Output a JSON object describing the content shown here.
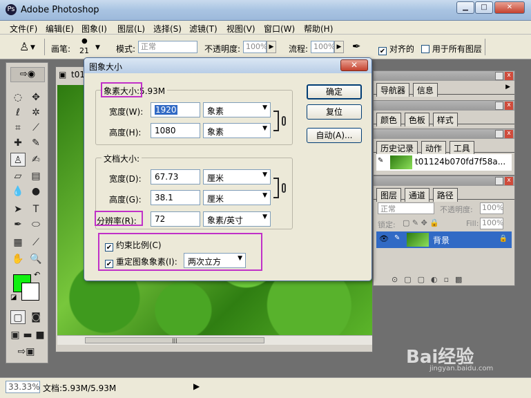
{
  "app": {
    "title": "Adobe Photoshop"
  },
  "window_buttons": {
    "minimize": "▁",
    "maximize": "□",
    "close": "✕"
  },
  "menu": [
    "文件(F)",
    "编辑(E)",
    "图象(I)",
    "图层(L)",
    "选择(S)",
    "滤镜(T)",
    "视图(V)",
    "窗口(W)",
    "帮助(H)"
  ],
  "options_bar": {
    "brush_label": "画笔:",
    "brush_size": "21",
    "mode_label": "模式:",
    "mode_value": "正常",
    "opacity_label": "不透明度:",
    "opacity_value": "100%",
    "flow_label": "流程:",
    "flow_value": "100%",
    "aligned_label": "对齐的",
    "all_layers_label": "用于所有图层",
    "aligned_checked": true,
    "all_layers_checked": false
  },
  "document": {
    "tab_title": "t01"
  },
  "palettes": {
    "navigator": {
      "tabs": [
        "导航器",
        "信息"
      ]
    },
    "color": {
      "tabs": [
        "颜色",
        "色板",
        "样式"
      ]
    },
    "history": {
      "tabs": [
        "历史记录",
        "动作",
        "工具"
      ],
      "snapshot_name": "t01124b070fd7f58a..."
    },
    "layers": {
      "tabs": [
        "图层",
        "通道",
        "路径"
      ],
      "blend_mode": "正常",
      "opacity_label": "不透明度:",
      "opacity_value": "100%",
      "lock_label": "锁定:",
      "fill_label": "Fill:",
      "fill_value": "100%",
      "layer_name": "背景"
    }
  },
  "dialog": {
    "title": "图象大小",
    "pixel_group": {
      "label": "象素大小",
      "size": ":5.93M"
    },
    "width_label": "宽度(W):",
    "width_value": "1920",
    "width_unit": "象素",
    "height_label": "高度(H):",
    "height_value": "1080",
    "height_unit": "象素",
    "doc_group": {
      "label": "文档大小:"
    },
    "doc_width_label": "宽度(D):",
    "doc_width_value": "67.73",
    "doc_width_unit": "厘米",
    "doc_height_label": "高度(G):",
    "doc_height_value": "38.1",
    "doc_height_unit": "厘米",
    "resolution_label": "分辨率(R):",
    "resolution_value": "72",
    "resolution_unit": "象素/英寸",
    "constrain_label": "约束比例(C)",
    "resample_label": "重定图象象素(I):",
    "resample_method": "两次立方",
    "constrain_checked": true,
    "resample_checked": true,
    "ok_label": "确定",
    "reset_label": "复位",
    "auto_label": "自动(A)...",
    "close_label": "✕"
  },
  "status": {
    "zoom": "33.33%",
    "doc_info": "文档:5.93M/5.93M"
  },
  "watermark": {
    "text": "Bai经验",
    "sub": "jingyan.baidu.com"
  },
  "colors": {
    "foreground": "#11f011",
    "background": "#ffffff",
    "highlight": "#c030c8"
  }
}
